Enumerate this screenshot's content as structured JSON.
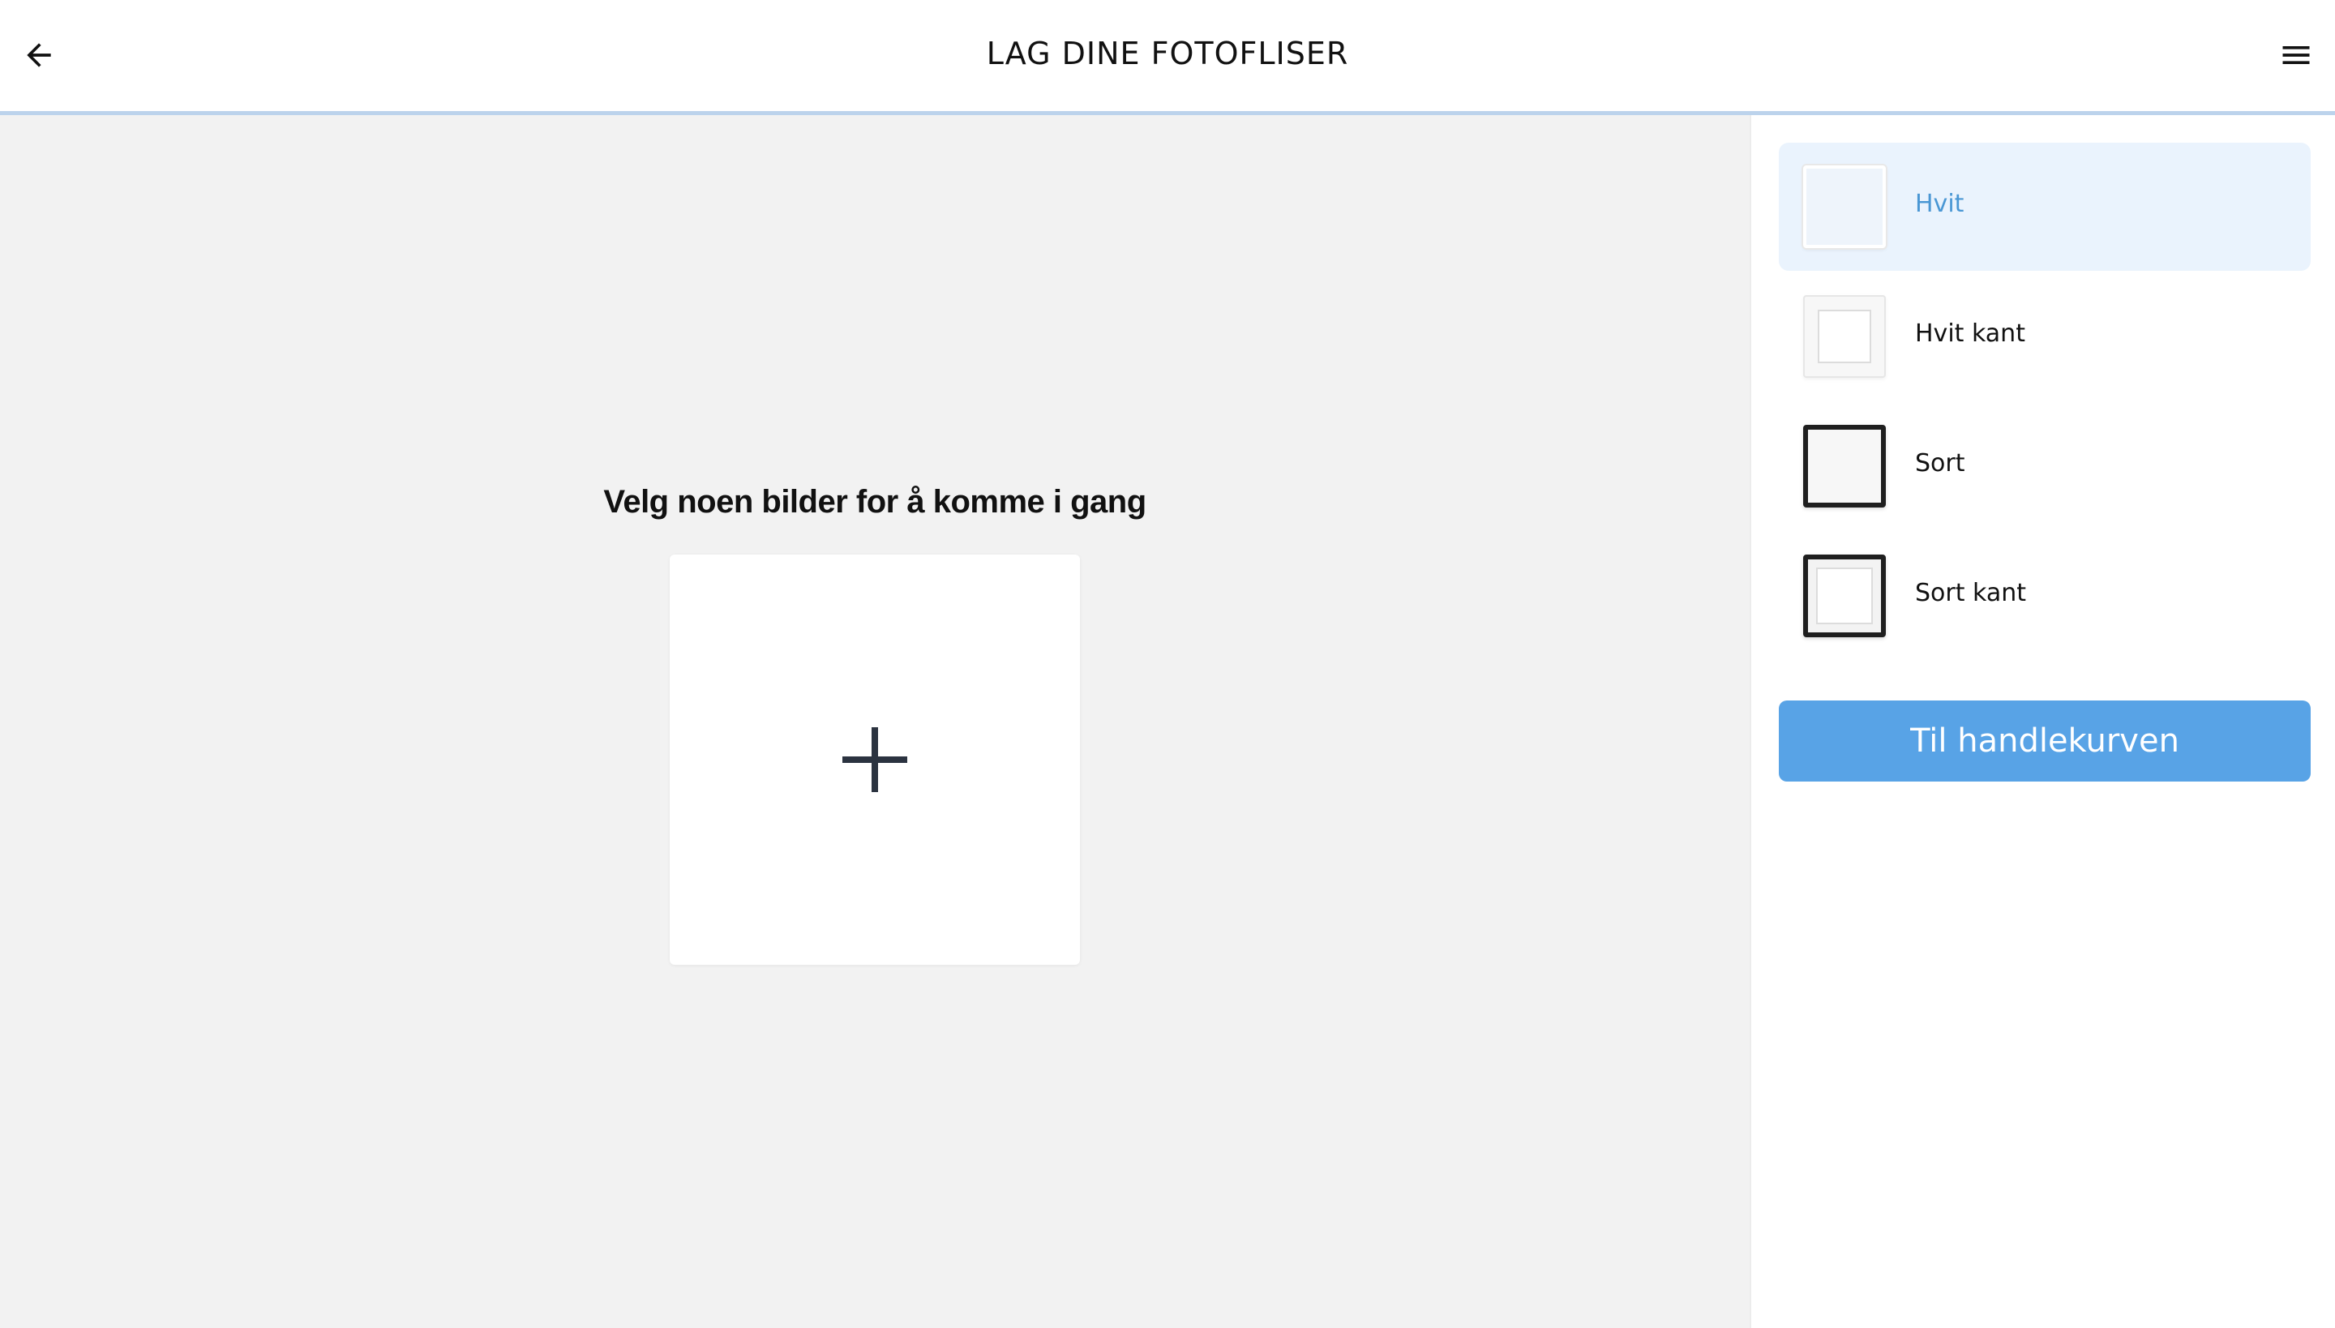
{
  "header": {
    "title": "LAG DINE FOTOFLISER",
    "back_icon": "arrow-left-icon",
    "menu_icon": "hamburger-menu-icon"
  },
  "main": {
    "prompt": "Velg noen bilder for å komme i gang",
    "add_icon": "plus-icon"
  },
  "sidebar": {
    "options": [
      {
        "label": "Hvit",
        "selected": true
      },
      {
        "label": "Hvit kant",
        "selected": false
      },
      {
        "label": "Sort",
        "selected": false
      },
      {
        "label": "Sort kant",
        "selected": false
      }
    ],
    "cart_button": "Til handlekurven"
  },
  "colors": {
    "accent": "#58a3e6",
    "selected_bg": "#eaf3fd",
    "selected_text": "#4a97d4",
    "canvas_bg": "#f2f2f2",
    "header_border": "#bcd3ec"
  }
}
